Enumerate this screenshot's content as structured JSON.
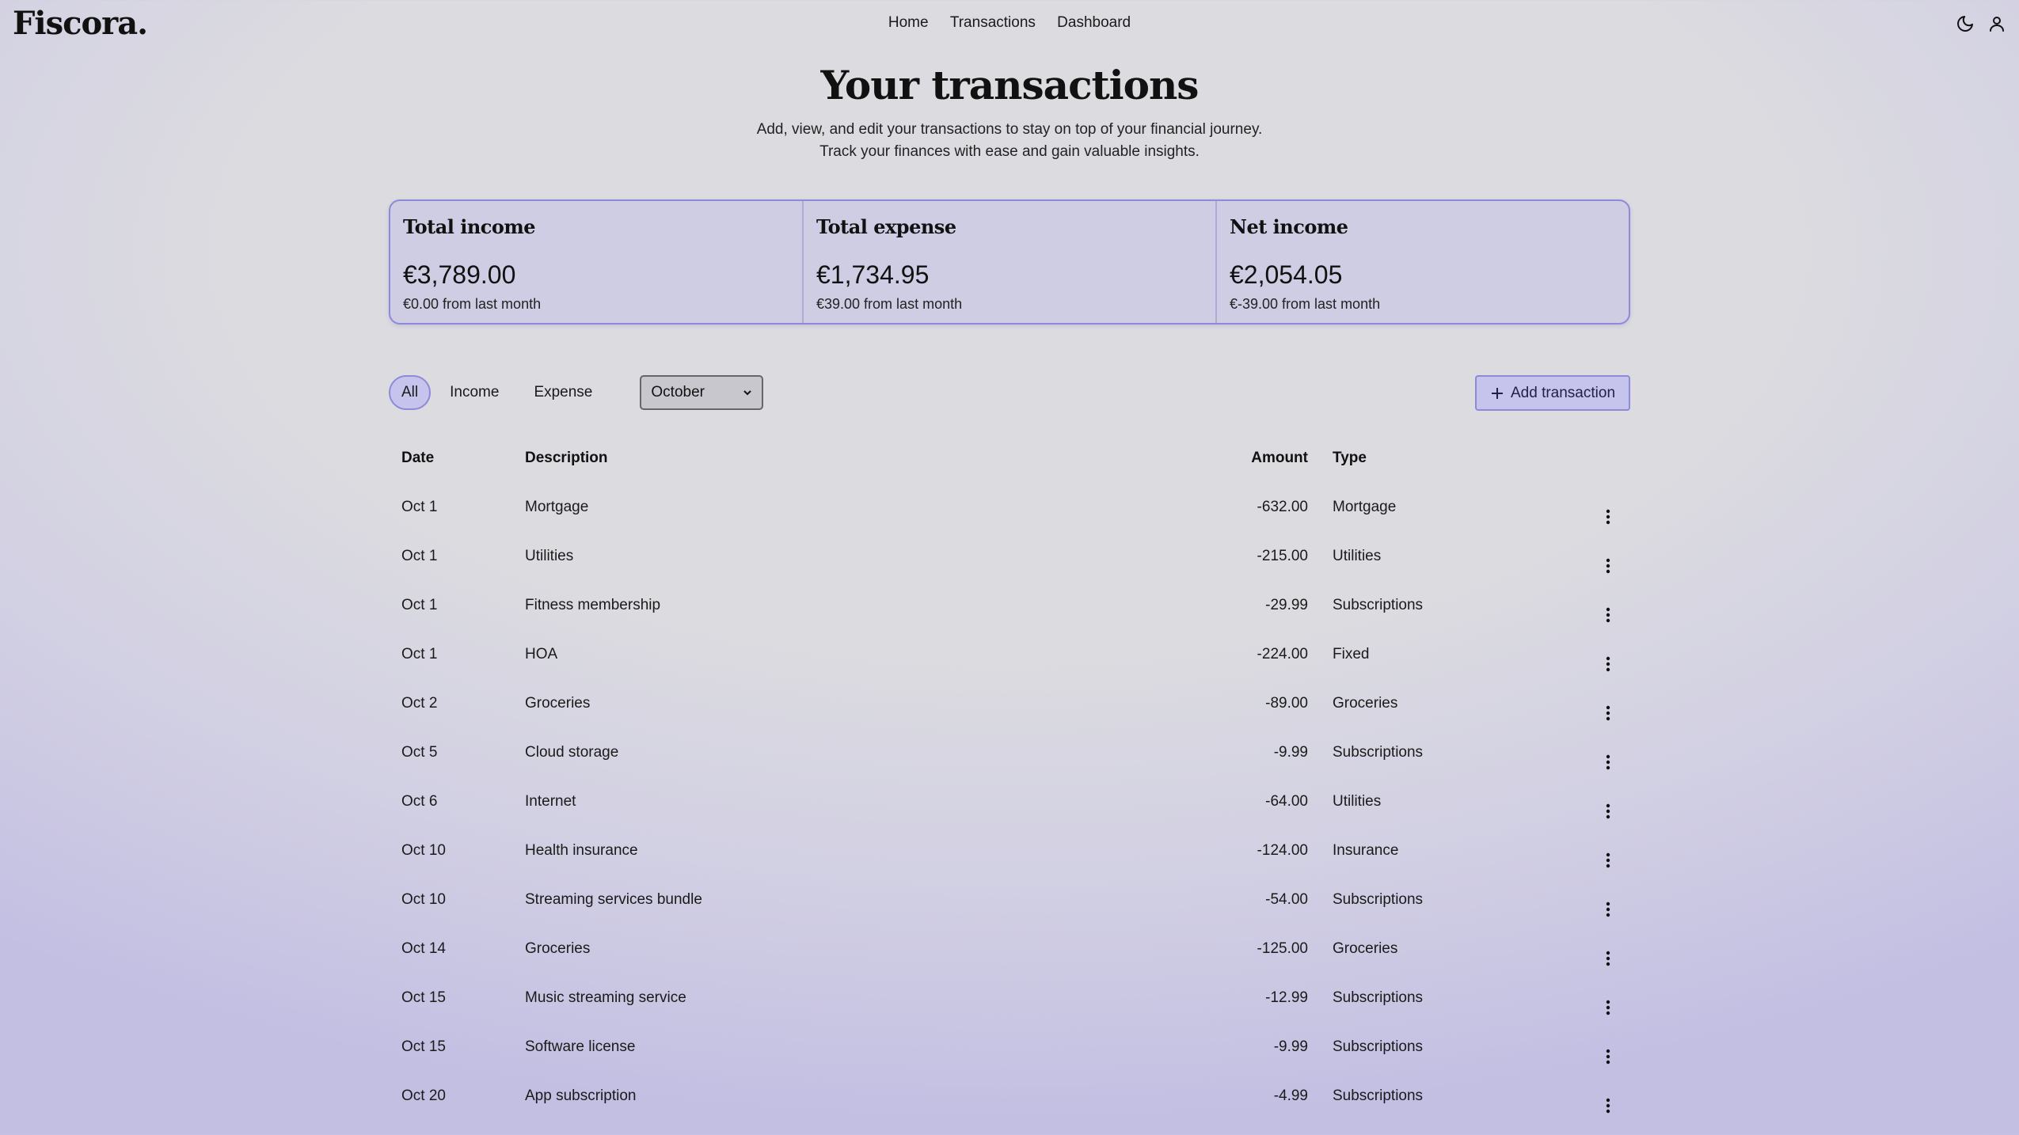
{
  "header": {
    "logo": "Fiscora.",
    "nav": [
      "Home",
      "Transactions",
      "Dashboard"
    ],
    "icons": [
      "moon-icon",
      "user-icon"
    ]
  },
  "page": {
    "title": "Your transactions",
    "subtitle_line1": "Add, view, and edit your transactions to stay on top of your financial journey.",
    "subtitle_line2": "Track your finances with ease and gain valuable insights."
  },
  "summary": [
    {
      "title": "Total income",
      "value": "€3,789.00",
      "change": "€0.00 from last month"
    },
    {
      "title": "Total expense",
      "value": "€1,734.95",
      "change": "€39.00 from last month"
    },
    {
      "title": "Net income",
      "value": "€2,054.05",
      "change": "€-39.00 from last month"
    }
  ],
  "filters": {
    "tabs": [
      "All",
      "Income",
      "Expense"
    ],
    "active": "All",
    "month": "October",
    "add_label": "Add transaction"
  },
  "table": {
    "headers": {
      "date": "Date",
      "description": "Description",
      "amount": "Amount",
      "type": "Type"
    },
    "rows": [
      {
        "date": "Oct 1",
        "description": "Mortgage",
        "amount": "-632.00",
        "type": "Mortgage"
      },
      {
        "date": "Oct 1",
        "description": "Utilities",
        "amount": "-215.00",
        "type": "Utilities"
      },
      {
        "date": "Oct 1",
        "description": "Fitness membership",
        "amount": "-29.99",
        "type": "Subscriptions"
      },
      {
        "date": "Oct 1",
        "description": "HOA",
        "amount": "-224.00",
        "type": "Fixed"
      },
      {
        "date": "Oct 2",
        "description": "Groceries",
        "amount": "-89.00",
        "type": "Groceries"
      },
      {
        "date": "Oct 5",
        "description": "Cloud storage",
        "amount": "-9.99",
        "type": "Subscriptions"
      },
      {
        "date": "Oct 6",
        "description": "Internet",
        "amount": "-64.00",
        "type": "Utilities"
      },
      {
        "date": "Oct 10",
        "description": "Health insurance",
        "amount": "-124.00",
        "type": "Insurance"
      },
      {
        "date": "Oct 10",
        "description": "Streaming services bundle",
        "amount": "-54.00",
        "type": "Subscriptions"
      },
      {
        "date": "Oct 14",
        "description": "Groceries",
        "amount": "-125.00",
        "type": "Groceries"
      },
      {
        "date": "Oct 15",
        "description": "Music streaming service",
        "amount": "-12.99",
        "type": "Subscriptions"
      },
      {
        "date": "Oct 15",
        "description": "Software license",
        "amount": "-9.99",
        "type": "Subscriptions"
      },
      {
        "date": "Oct 20",
        "description": "App subscription",
        "amount": "-4.99",
        "type": "Subscriptions"
      }
    ]
  },
  "colors": {
    "accent": "#8d8ad8",
    "accent_fill": "#c6c4ec",
    "card_fill": "#cfcde3"
  }
}
